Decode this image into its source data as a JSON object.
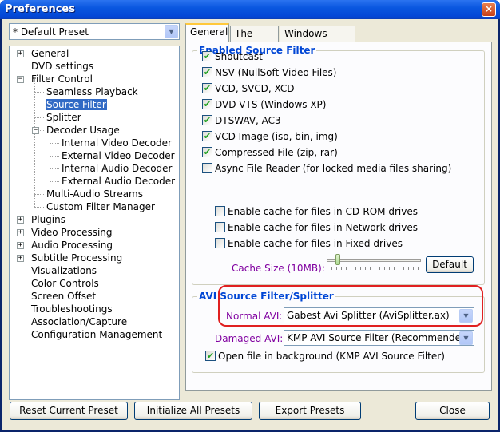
{
  "window": {
    "title": "Preferences",
    "close_glyph": "×"
  },
  "preset": {
    "value": "* Default Preset"
  },
  "tree": {
    "items": [
      {
        "label": "General",
        "expander": "+"
      },
      {
        "label": "DVD settings"
      },
      {
        "label": "Filter Control",
        "expander": "−"
      },
      {
        "label": "Seamless Playback"
      },
      {
        "label": "Source Filter",
        "selected": true
      },
      {
        "label": "Splitter"
      },
      {
        "label": "Decoder Usage",
        "expander": "−"
      },
      {
        "label": "Internal Video Decoder"
      },
      {
        "label": "External Video Decoder"
      },
      {
        "label": "Internal Audio Decoder"
      },
      {
        "label": "External Audio Decoder"
      },
      {
        "label": "Multi-Audio Streams"
      },
      {
        "label": "Custom Filter Manager"
      },
      {
        "label": "Plugins",
        "expander": "+"
      },
      {
        "label": "Video Processing",
        "expander": "+"
      },
      {
        "label": "Audio Processing",
        "expander": "+"
      },
      {
        "label": "Subtitle Processing",
        "expander": "+"
      },
      {
        "label": "Visualizations"
      },
      {
        "label": "Color Controls"
      },
      {
        "label": "Screen Offset"
      },
      {
        "label": "Troubleshootings"
      },
      {
        "label": "Association/Capture"
      },
      {
        "label": "Configuration Management"
      }
    ]
  },
  "tabs": [
    {
      "label": "General",
      "active": true
    },
    {
      "label": "The Rest"
    },
    {
      "label": "Windows Media"
    }
  ],
  "source_filter": {
    "title": "Enabled Source Filter",
    "checks": [
      {
        "label": "Shoutcast",
        "checked": true
      },
      {
        "label": "NSV (NullSoft Video Files)",
        "checked": true
      },
      {
        "label": "VCD, SVCD, XCD",
        "checked": true
      },
      {
        "label": "DVD VTS (Windows XP)",
        "checked": true
      },
      {
        "label": "DTSWAV, AC3",
        "checked": true
      },
      {
        "label": "VCD Image (iso, bin, img)",
        "checked": true
      },
      {
        "label": "Compressed File (zip, rar)",
        "checked": true
      },
      {
        "label": "Async File Reader (for locked media files sharing)",
        "checked": false
      }
    ],
    "cache_checks": [
      {
        "label": "Enable cache for files in CD-ROM drives",
        "checked": false
      },
      {
        "label": "Enable cache for files in Network drives",
        "checked": false
      },
      {
        "label": "Enable cache for files in Fixed drives",
        "checked": false
      }
    ],
    "cache_size_label": "Cache Size (10MB):",
    "cache_slider_value": 0.1,
    "default_button": "Default"
  },
  "avi": {
    "title": "AVI Source Filter/Splitter",
    "normal_label": "Normal AVI:",
    "normal_value": "Gabest Avi Splitter (AviSplitter.ax)",
    "damaged_label": "Damaged AVI:",
    "damaged_value": "KMP AVI Source Filter (Recommended)",
    "open_bg_label": "Open file in background (KMP AVI Source Filter)",
    "open_bg_checked": true
  },
  "buttons": {
    "reset": "Reset Current Preset",
    "initialize": "Initialize All Presets",
    "export": "Export Presets",
    "close": "Close"
  },
  "glyphs": {
    "check": "✔",
    "dropdown": "▼"
  },
  "colors": {
    "title_bar": "#0a57e0",
    "selection": "#316ac5",
    "group_title": "#0046d5",
    "label_purple": "#8000a0",
    "highlight": "#e02020"
  }
}
